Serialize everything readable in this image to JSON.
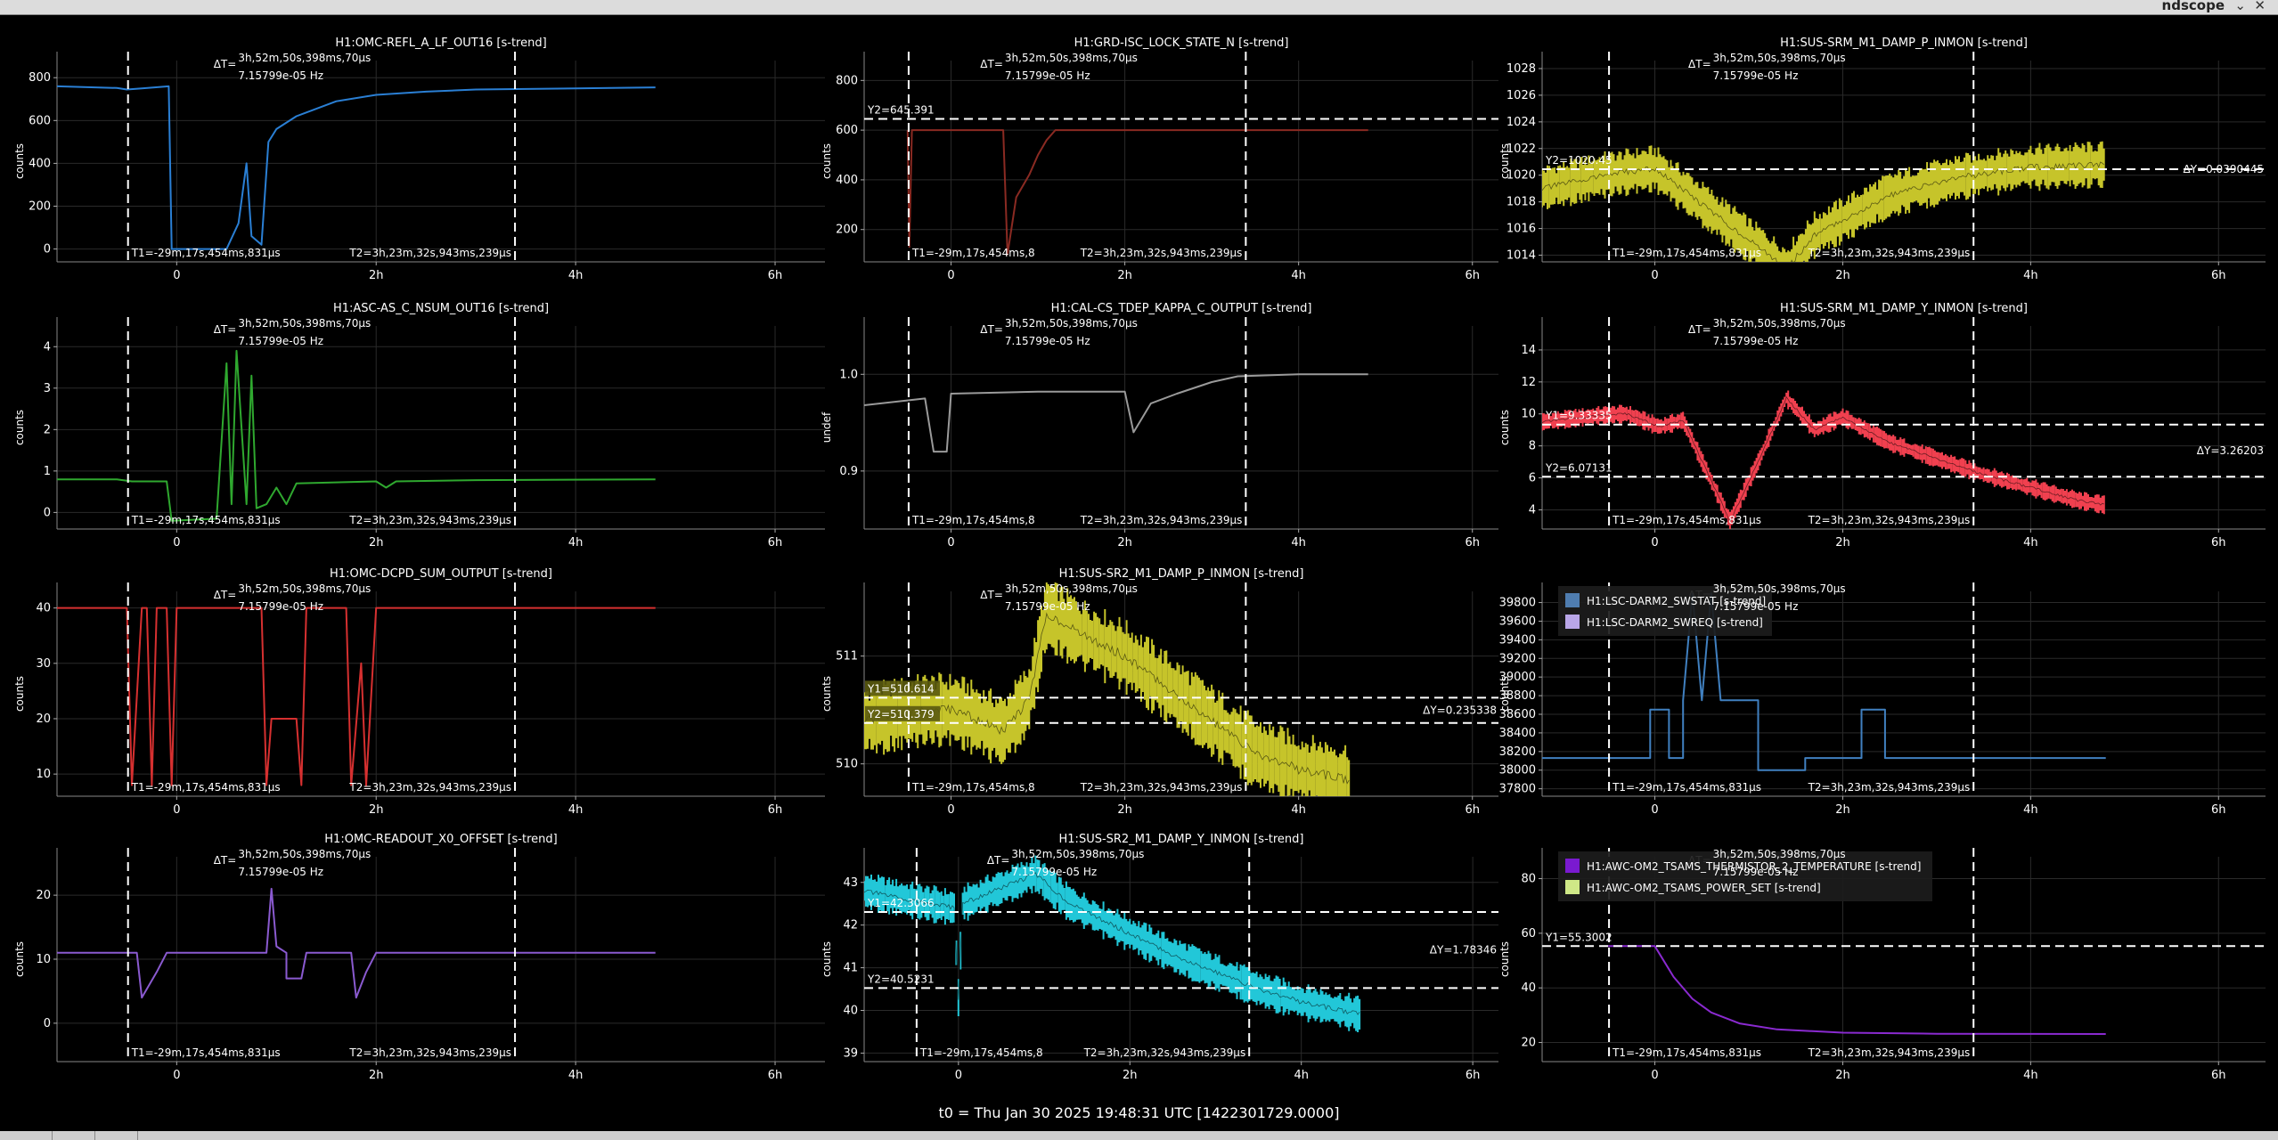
{
  "window": {
    "title": "ndscope",
    "min_glyph": "⌄",
    "close_glyph": "✕"
  },
  "footer": {
    "t0": "t0 = Thu Jan 30 2025 19:48:31 UTC [1422301729.0000]"
  },
  "delta_t": {
    "label": "ΔT=",
    "line1": "3h,52m,50s,398ms,70µs",
    "line2": "7.15799e-05 Hz"
  },
  "cursors": {
    "t1_label": "T1=-29m,17s,454ms,831µs",
    "t1_label_short": "T1=-29m,17s,454ms,8",
    "t2_label": "T2=3h,23m,32s,943ms,239µs",
    "t1_hours": -0.488,
    "t2_hours": 3.392
  },
  "x_ticks": [
    "0",
    "2h",
    "4h",
    "6h"
  ],
  "x_tick_hours": [
    0,
    2,
    4,
    6
  ],
  "plots": [
    {
      "id": "p1",
      "title": "H1:OMC-REFL_A_LF_OUT16 [s-trend]",
      "ylabel": "counts",
      "yticks": [
        "800",
        "600",
        "400",
        "200",
        "0"
      ],
      "ytick_values": [
        800,
        600,
        400,
        200,
        0
      ],
      "ylim": [
        -60,
        880
      ],
      "xlim": [
        -1.2,
        6.5
      ],
      "color": "#2a7fd4",
      "trace": [
        [
          -1.2,
          760
        ],
        [
          -0.6,
          752
        ],
        [
          -0.5,
          745
        ],
        [
          -0.35,
          750
        ],
        [
          -0.08,
          760
        ],
        [
          -0.05,
          0
        ],
        [
          0.3,
          0
        ],
        [
          0.5,
          0
        ],
        [
          0.62,
          120
        ],
        [
          0.7,
          400
        ],
        [
          0.75,
          60
        ],
        [
          0.85,
          20
        ],
        [
          0.92,
          500
        ],
        [
          1.0,
          560
        ],
        [
          1.2,
          620
        ],
        [
          1.6,
          690
        ],
        [
          2.0,
          720
        ],
        [
          2.5,
          735
        ],
        [
          3.0,
          745
        ],
        [
          4.0,
          750
        ],
        [
          4.8,
          755
        ]
      ],
      "series": []
    },
    {
      "id": "p2",
      "title": "H1:GRD-ISC_LOCK_STATE_N [s-trend]",
      "ylabel": "counts",
      "yticks": [
        "800",
        "600",
        "400",
        "200"
      ],
      "ytick_values": [
        800,
        600,
        400,
        200
      ],
      "ylim": [
        70,
        880
      ],
      "xlim": [
        -1.0,
        6.3
      ],
      "color": "#8a2a22",
      "trace": [
        [
          -0.5,
          600
        ],
        [
          -0.48,
          130
        ],
        [
          -0.45,
          600
        ],
        [
          0.6,
          600
        ],
        [
          0.65,
          100
        ],
        [
          0.75,
          330
        ],
        [
          0.9,
          420
        ],
        [
          1.0,
          500
        ],
        [
          1.1,
          560
        ],
        [
          1.2,
          600
        ],
        [
          4.0,
          600
        ],
        [
          4.8,
          600
        ]
      ],
      "cursor_y": [
        {
          "label": "Y2=645.391",
          "value": 645.391
        }
      ],
      "series": []
    },
    {
      "id": "p3",
      "title": "H1:SUS-SRM_M1_DAMP_P_INMON [s-trend]",
      "ylabel": "counts",
      "yticks": [
        "1028",
        "1026",
        "1024",
        "1022",
        "1020",
        "1018",
        "1016",
        "1014"
      ],
      "ytick_values": [
        1028,
        1026,
        1024,
        1022,
        1020,
        1018,
        1016,
        1014
      ],
      "ylim": [
        1013.5,
        1028.6
      ],
      "xlim": [
        -1.2,
        6.5
      ],
      "color": "#c6c42a",
      "band": {
        "center": [
          [
            -1.2,
            1019
          ],
          [
            -0.55,
            1020
          ],
          [
            0,
            1020.5
          ],
          [
            1.4,
            1013
          ],
          [
            1.7,
            1015.5
          ],
          [
            2.5,
            1018.5
          ],
          [
            3.2,
            1019.8
          ],
          [
            4.0,
            1020.6
          ],
          [
            4.8,
            1020.8
          ]
        ],
        "width": 1.8
      },
      "cursor_y": [
        {
          "label": "Y2=1020.45",
          "value": 1020.45
        }
      ],
      "delta_y": "ΔY=0.0390445",
      "series": []
    },
    {
      "id": "p4",
      "title": "H1:ASC-AS_C_NSUM_OUT16 [s-trend]",
      "ylabel": "counts",
      "yticks": [
        "4",
        "3",
        "2",
        "1",
        "0"
      ],
      "ytick_values": [
        4,
        3,
        2,
        1,
        0
      ],
      "ylim": [
        -0.4,
        4.5
      ],
      "xlim": [
        -1.2,
        6.5
      ],
      "color": "#2fa82f",
      "trace": [
        [
          -1.2,
          0.8
        ],
        [
          -0.6,
          0.8
        ],
        [
          -0.45,
          0.75
        ],
        [
          -0.1,
          0.75
        ],
        [
          -0.05,
          -0.2
        ],
        [
          0.4,
          -0.15
        ],
        [
          0.5,
          3.6
        ],
        [
          0.55,
          0.2
        ],
        [
          0.6,
          3.9
        ],
        [
          0.7,
          0.2
        ],
        [
          0.75,
          3.3
        ],
        [
          0.8,
          0.1
        ],
        [
          0.9,
          0.2
        ],
        [
          1.0,
          0.6
        ],
        [
          1.1,
          0.2
        ],
        [
          1.2,
          0.7
        ],
        [
          2.0,
          0.75
        ],
        [
          2.1,
          0.6
        ],
        [
          2.2,
          0.75
        ],
        [
          3.0,
          0.78
        ],
        [
          4.8,
          0.8
        ]
      ],
      "series": []
    },
    {
      "id": "p5",
      "title": "H1:CAL-CS_TDEP_KAPPA_C_OUTPUT [s-trend]",
      "ylabel": "undef",
      "yticks": [
        "1.0",
        "0.9"
      ],
      "ytick_values": [
        1.0,
        0.9
      ],
      "ylim": [
        0.84,
        1.05
      ],
      "xlim": [
        -1.0,
        6.3
      ],
      "color": "#9a9a9a",
      "trace": [
        [
          -1.0,
          0.968
        ],
        [
          -0.3,
          0.975
        ],
        [
          -0.2,
          0.92
        ],
        [
          -0.05,
          0.92
        ],
        [
          0.0,
          0.98
        ],
        [
          1.0,
          0.982
        ],
        [
          2.0,
          0.982
        ],
        [
          2.1,
          0.94
        ],
        [
          2.3,
          0.97
        ],
        [
          2.6,
          0.98
        ],
        [
          3.0,
          0.992
        ],
        [
          3.3,
          0.998
        ],
        [
          4.0,
          1.0
        ],
        [
          4.8,
          1.0
        ]
      ],
      "series": []
    },
    {
      "id": "p6",
      "title": "H1:SUS-SRM_M1_DAMP_Y_INMON [s-trend]",
      "ylabel": "counts",
      "yticks": [
        "14",
        "12",
        "10",
        "8",
        "6",
        "4"
      ],
      "ytick_values": [
        14,
        12,
        10,
        8,
        6,
        4
      ],
      "ylim": [
        2.8,
        15.5
      ],
      "xlim": [
        -1.2,
        6.5
      ],
      "color": "#f0404f",
      "band": {
        "center": [
          [
            -1.2,
            9.5
          ],
          [
            -0.6,
            9.9
          ],
          [
            -0.3,
            10.0
          ],
          [
            0.05,
            9.2
          ],
          [
            0.3,
            9.6
          ],
          [
            0.8,
            3.3
          ],
          [
            1.1,
            7.0
          ],
          [
            1.4,
            11.0
          ],
          [
            1.7,
            9.0
          ],
          [
            2.0,
            9.8
          ],
          [
            2.5,
            8.2
          ],
          [
            3.0,
            7.2
          ],
          [
            3.5,
            6.2
          ],
          [
            4.0,
            5.4
          ],
          [
            4.5,
            4.6
          ],
          [
            4.8,
            4.3
          ]
        ],
        "width": 0.6
      },
      "cursor_y": [
        {
          "label": "Y1=9.33335",
          "value": 9.33335
        },
        {
          "label": "Y2=6.07131",
          "value": 6.07131
        }
      ],
      "delta_y": "ΔY=3.26203",
      "series": []
    },
    {
      "id": "p7",
      "title": "H1:OMC-DCPD_SUM_OUTPUT [s-trend]",
      "ylabel": "counts",
      "yticks": [
        "40",
        "30",
        "20",
        "10"
      ],
      "ytick_values": [
        40,
        30,
        20,
        10
      ],
      "ylim": [
        6,
        43
      ],
      "xlim": [
        -1.2,
        6.5
      ],
      "color": "#d63030",
      "trace": [
        [
          -1.2,
          40
        ],
        [
          -0.5,
          40
        ],
        [
          -0.45,
          8
        ],
        [
          -0.35,
          40
        ],
        [
          -0.3,
          40
        ],
        [
          -0.25,
          8
        ],
        [
          -0.2,
          40
        ],
        [
          -0.1,
          40
        ],
        [
          -0.05,
          8
        ],
        [
          0.0,
          40
        ],
        [
          0.85,
          40
        ],
        [
          0.9,
          8
        ],
        [
          0.95,
          20
        ],
        [
          1.2,
          20
        ],
        [
          1.25,
          8
        ],
        [
          1.3,
          40
        ],
        [
          1.7,
          40
        ],
        [
          1.75,
          8
        ],
        [
          1.85,
          30
        ],
        [
          1.9,
          8
        ],
        [
          2.0,
          40
        ],
        [
          4.8,
          40
        ]
      ],
      "series": []
    },
    {
      "id": "p8",
      "title": "H1:SUS-SR2_M1_DAMP_P_INMON [s-trend]",
      "ylabel": "counts",
      "yticks": [
        "511",
        "510"
      ],
      "ytick_values": [
        511,
        510
      ],
      "ylim": [
        509.7,
        511.6
      ],
      "xlim": [
        -1.0,
        6.3
      ],
      "color": "#c6c42a",
      "band": {
        "center": [
          [
            -1.0,
            510.4
          ],
          [
            -0.3,
            510.5
          ],
          [
            0.05,
            510.5
          ],
          [
            0.6,
            510.3
          ],
          [
            0.9,
            510.6
          ],
          [
            1.1,
            511.4
          ],
          [
            1.5,
            511.2
          ],
          [
            2.0,
            511.0
          ],
          [
            2.5,
            510.7
          ],
          [
            3.0,
            510.4
          ],
          [
            3.5,
            510.1
          ],
          [
            4.0,
            509.95
          ],
          [
            4.6,
            509.85
          ]
        ],
        "width": 0.35
      },
      "cursor_y": [
        {
          "label": "Y1=510.614",
          "value": 510.614
        },
        {
          "label": "Y2=510.379",
          "value": 510.379
        }
      ],
      "delta_y": "ΔY=0.235338",
      "series": []
    },
    {
      "id": "p9",
      "title": "",
      "ylabel": "counts",
      "yticks": [
        "39800",
        "39600",
        "39400",
        "39200",
        "39000",
        "38800",
        "38600",
        "38400",
        "38200",
        "38000",
        "37800"
      ],
      "ytick_values": [
        39800,
        39600,
        39400,
        39200,
        39000,
        38800,
        38600,
        38400,
        38200,
        38000,
        37800
      ],
      "ylim": [
        37720,
        39920
      ],
      "xlim": [
        -1.2,
        6.5
      ],
      "color": "#4080c0",
      "trace": [
        [
          -1.2,
          38130
        ],
        [
          -0.05,
          38130
        ],
        [
          -0.05,
          38650
        ],
        [
          0.15,
          38650
        ],
        [
          0.15,
          38130
        ],
        [
          0.3,
          38130
        ],
        [
          0.3,
          38750
        ],
        [
          0.4,
          39900
        ],
        [
          0.5,
          38750
        ],
        [
          0.6,
          39900
        ],
        [
          0.7,
          38750
        ],
        [
          1.1,
          38750
        ],
        [
          1.1,
          38000
        ],
        [
          1.6,
          38000
        ],
        [
          1.6,
          38130
        ],
        [
          2.2,
          38130
        ],
        [
          2.2,
          38650
        ],
        [
          2.45,
          38650
        ],
        [
          2.45,
          38130
        ],
        [
          4.0,
          38130
        ],
        [
          4.8,
          38130
        ]
      ],
      "series": [
        {
          "name": "H1:LSC-DARM2_SWSTAT [s-trend]",
          "color": "#4f7db0"
        },
        {
          "name": "H1:LSC-DARM2_SWREQ [s-trend]",
          "color": "#b9a6e8"
        }
      ]
    },
    {
      "id": "p10",
      "title": "H1:OMC-READOUT_X0_OFFSET [s-trend]",
      "ylabel": "counts",
      "yticks": [
        "20",
        "10",
        "0"
      ],
      "ytick_values": [
        20,
        10,
        0
      ],
      "ylim": [
        -6,
        26
      ],
      "xlim": [
        -1.2,
        6.5
      ],
      "color": "#8a5ad0",
      "trace": [
        [
          -1.2,
          11
        ],
        [
          -0.4,
          11
        ],
        [
          -0.35,
          4
        ],
        [
          -0.2,
          8
        ],
        [
          -0.1,
          11
        ],
        [
          0.9,
          11
        ],
        [
          0.95,
          21
        ],
        [
          1.0,
          12
        ],
        [
          1.1,
          11
        ],
        [
          1.1,
          7
        ],
        [
          1.25,
          7
        ],
        [
          1.3,
          11
        ],
        [
          1.75,
          11
        ],
        [
          1.8,
          4
        ],
        [
          1.9,
          8
        ],
        [
          2.0,
          11
        ],
        [
          4.8,
          11
        ]
      ],
      "series": []
    },
    {
      "id": "p11",
      "title": "H1:SUS-SR2_M1_DAMP_Y_INMON [s-trend]",
      "ylabel": "counts",
      "yticks": [
        "43",
        "42",
        "41",
        "40",
        "39"
      ],
      "ytick_values": [
        43,
        42,
        41,
        40,
        39
      ],
      "ylim": [
        38.8,
        43.6
      ],
      "xlim": [
        -1.1,
        6.3
      ],
      "color": "#22c7d8",
      "band": {
        "center": [
          [
            -1.1,
            42.8
          ],
          [
            -0.6,
            42.6
          ],
          [
            -0.05,
            42.4
          ],
          [
            0.0,
            40.3
          ],
          [
            0.05,
            42.5
          ],
          [
            0.9,
            43.2
          ],
          [
            1.3,
            42.5
          ],
          [
            2.0,
            41.8
          ],
          [
            2.5,
            41.3
          ],
          [
            3.0,
            40.9
          ],
          [
            3.5,
            40.5
          ],
          [
            4.0,
            40.2
          ],
          [
            4.7,
            39.9
          ]
        ],
        "width": 0.45
      },
      "cursor_y": [
        {
          "label": "Y1=42.3066",
          "value": 42.3066
        },
        {
          "label": "Y2=40.5231",
          "value": 40.5231
        }
      ],
      "delta_y": "ΔY=1.78346",
      "series": []
    },
    {
      "id": "p12",
      "title": "",
      "ylabel": "counts",
      "yticks": [
        "80",
        "60",
        "40",
        "20"
      ],
      "ytick_values": [
        80,
        60,
        40,
        20
      ],
      "ylim": [
        13,
        88
      ],
      "xlim": [
        -1.2,
        6.5
      ],
      "color": "#8a2ad0",
      "trace": [
        [
          -0.5,
          55.3
        ],
        [
          0.0,
          55.3
        ],
        [
          0.2,
          44
        ],
        [
          0.4,
          36
        ],
        [
          0.6,
          31
        ],
        [
          0.9,
          27
        ],
        [
          1.3,
          24.8
        ],
        [
          2.0,
          23.6
        ],
        [
          3.0,
          23.2
        ],
        [
          4.8,
          23.1
        ]
      ],
      "cursor_y": [
        {
          "label": "Y1=55.3002",
          "value": 55.3002
        }
      ],
      "series": [
        {
          "name": "H1:AWC-OM2_TSAMS_THERMISTOR_2_TEMPERATURE [s-trend]",
          "color": "#7a1ad0"
        },
        {
          "name": "H1:AWC-OM2_TSAMS_POWER_SET [s-trend]",
          "color": "#cfe887"
        }
      ]
    }
  ]
}
